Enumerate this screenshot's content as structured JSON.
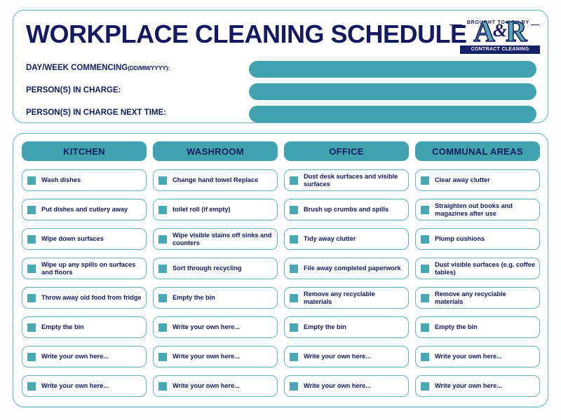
{
  "document": {
    "title": "WORKPLACE CLEANING SCHEDULE"
  },
  "logo": {
    "brought_to_you_by": "BROUGHT TO YOU BY",
    "letter_a": "A",
    "ampersand": "&",
    "letter_r": "R",
    "tagline": "CONTRACT CLEANING SPECIALISTS"
  },
  "form": {
    "fields": [
      {
        "label": "DAY/WEEK COMMENCING",
        "sublabel": "(DD/MM/YYYY):",
        "value": ""
      },
      {
        "label": "PERSON(S) IN CHARGE:",
        "sublabel": "",
        "value": ""
      },
      {
        "label": "PERSON(S) IN CHARGE NEXT TIME:",
        "sublabel": "",
        "value": ""
      }
    ]
  },
  "columns": [
    {
      "header": "KITCHEN",
      "tasks": [
        "Wash dishes",
        "Put dishes and cutlery away",
        "Wipe down surfaces",
        "Wipe up any spills on surfaces and floors",
        "Throw away old food from fridge",
        "Empty the bin",
        "Write your own here...",
        "Write your own here..."
      ]
    },
    {
      "header": "WASHROOM",
      "tasks": [
        "Change hand towel Replace",
        "toilet roll (if empty)",
        "Wipe visible stains off sinks and counters",
        "Sort through recycling",
        "Empty the bin",
        "Write your own here...",
        "Write your own here...",
        "Write your own here..."
      ]
    },
    {
      "header": "OFFICE",
      "tasks": [
        "Dust desk surfaces and visible surfaces",
        "Brush up crumbs and spills",
        "Tidy away clutter",
        "File away completed paperwork",
        "Remove any recyclable materials",
        "Empty the bin",
        "Write your own here...",
        "Write your own here..."
      ]
    },
    {
      "header": "COMMUNAL AREAS",
      "tasks": [
        "Clear away clutter",
        "Straighten out books and magazines after use",
        "Plump cushions",
        "Dust visible surfaces (e.g. coffee tables)",
        "Remove any recyclable materials",
        "Empty the bin",
        "Write your own here...",
        "Write your own here..."
      ]
    }
  ],
  "colors": {
    "teal": "#41a3b0",
    "teal_border": "#63b3bb",
    "navy": "#141a60",
    "checkbox": "#48a8b3",
    "background": "#fdfdfd"
  }
}
